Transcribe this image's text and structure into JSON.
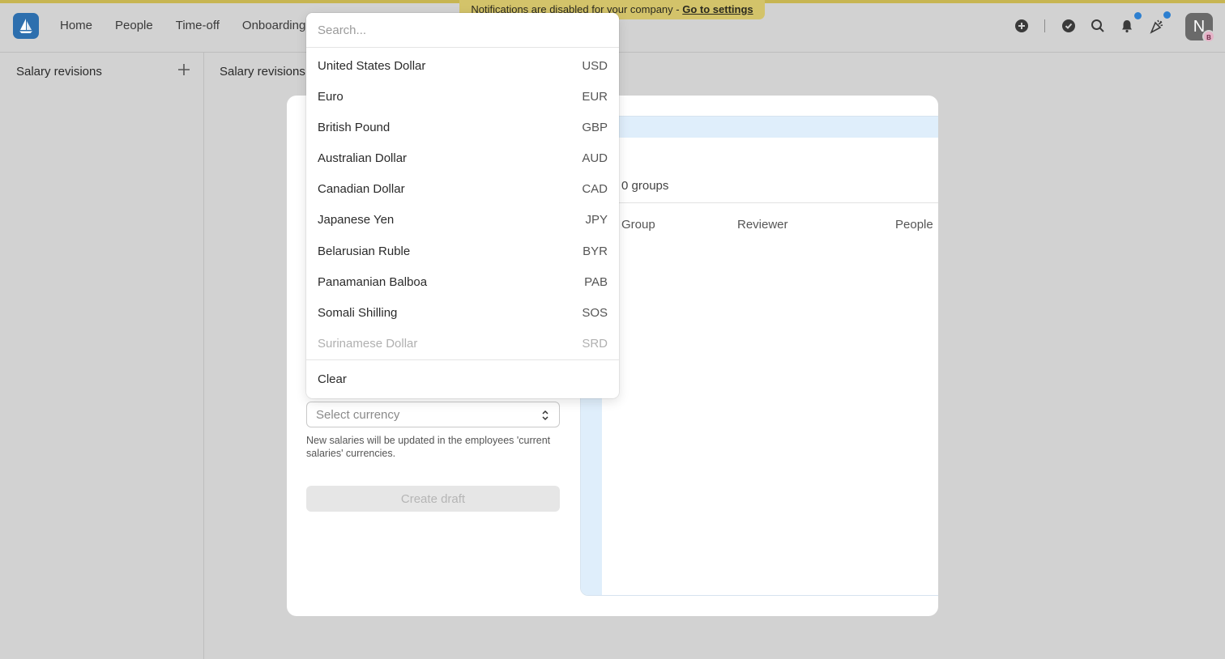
{
  "banner": {
    "text": "Notifications are disabled for your company - ",
    "link": "Go to settings"
  },
  "nav": {
    "items": [
      "Home",
      "People",
      "Time-off",
      "Onboarding"
    ]
  },
  "user": {
    "initial": "N",
    "badge": "B"
  },
  "sidebar": {
    "title": "Salary revisions"
  },
  "main": {
    "title": "Salary revisions"
  },
  "modal": {
    "groups_label": "0 groups",
    "columns": [
      "Group",
      "Reviewer",
      "People"
    ],
    "select_placeholder": "Select currency",
    "helper_text": "New salaries will be updated in the employees 'current salaries' currencies.",
    "create_button": "Create draft"
  },
  "dropdown": {
    "search_placeholder": "Search...",
    "options": [
      {
        "name": "United States Dollar",
        "code": "USD"
      },
      {
        "name": "Euro",
        "code": "EUR"
      },
      {
        "name": "British Pound",
        "code": "GBP"
      },
      {
        "name": "Australian Dollar",
        "code": "AUD"
      },
      {
        "name": "Canadian Dollar",
        "code": "CAD"
      },
      {
        "name": "Japanese Yen",
        "code": "JPY"
      },
      {
        "name": "Belarusian Ruble",
        "code": "BYR"
      },
      {
        "name": "Panamanian Balboa",
        "code": "PAB"
      },
      {
        "name": "Somali Shilling",
        "code": "SOS"
      },
      {
        "name": "Surinamese Dollar",
        "code": "SRD"
      }
    ],
    "clear_label": "Clear"
  },
  "colors": {
    "logo": "#2d6fae",
    "banner": "#d3c36a",
    "notification_dot": "#2d7fd0",
    "panel_tint": "#dfeefb"
  }
}
